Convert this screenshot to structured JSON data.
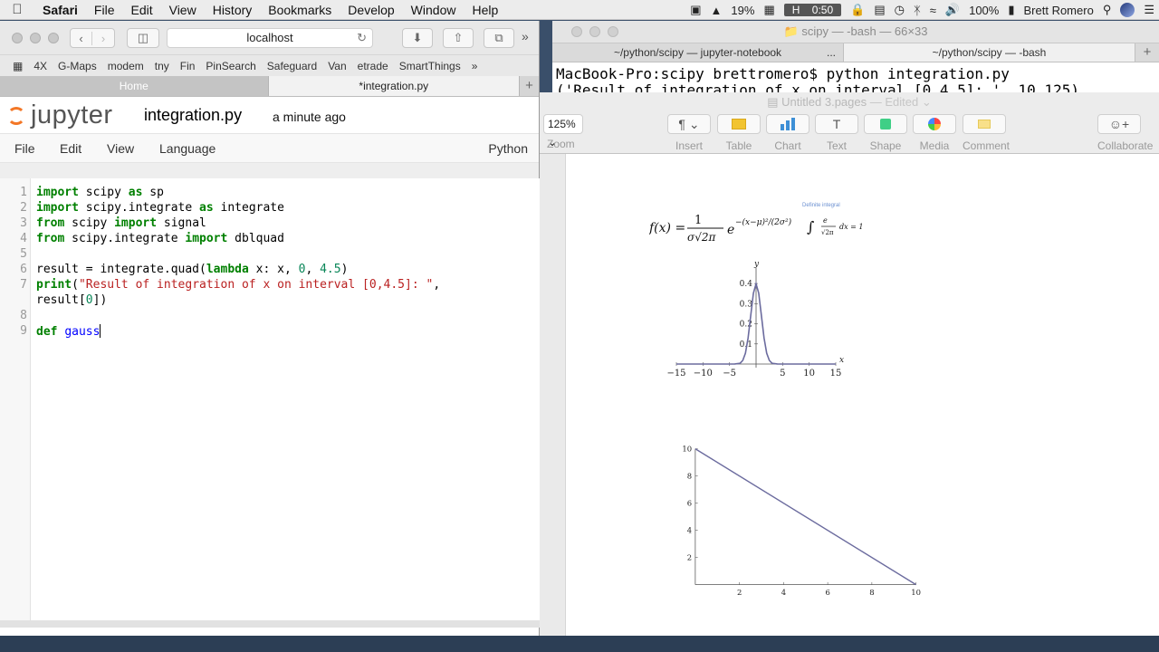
{
  "menubar": {
    "app": "Safari",
    "items": [
      "File",
      "Edit",
      "View",
      "History",
      "Bookmarks",
      "Develop",
      "Window",
      "Help"
    ],
    "battery_pct": "19%",
    "clock_label": "H",
    "time": "0:50",
    "volume_battery": "100%",
    "user": "Brett Romero"
  },
  "safari": {
    "address": "localhost",
    "bookmarks": [
      "4X",
      "G-Maps",
      "modem",
      "tny",
      "Fin",
      "PinSearch",
      "Safeguard",
      "Van",
      "etrade",
      "SmartThings"
    ],
    "tabs": [
      "Home",
      "*integration.py"
    ]
  },
  "jupyter": {
    "logo": "jupyter",
    "filename": "integration.py",
    "saved": "a minute ago",
    "menu": [
      "File",
      "Edit",
      "View",
      "Language"
    ],
    "kernel": "Python",
    "line_numbers": [
      "1",
      "2",
      "3",
      "4",
      "5",
      "6",
      "7",
      "8",
      "9"
    ]
  },
  "terminal": {
    "title": "scipy — -bash — 66×33",
    "tabs": [
      "~/python/scipy — jupyter-notebook",
      "~/python/scipy — -bash"
    ],
    "lines": [
      "MacBook-Pro:scipy brettromero$ python integration.py",
      "('Result of integration of x on interval [0,4.5]: ', 10.125)"
    ]
  },
  "pages": {
    "title": "Untitled 3.pages",
    "edited": "— Edited",
    "zoom": "125%",
    "zoom_label": "Zoom",
    "tools": [
      "Insert",
      "Table",
      "Chart",
      "Text",
      "Shape",
      "Media",
      "Comment",
      "Collaborate"
    ],
    "formula_caption": "Definite integral",
    "formula_rhs": "dx = 1"
  },
  "chart_data": [
    {
      "type": "line",
      "xlabel": "x",
      "ylabel": "y",
      "xlim": [
        -15,
        15
      ],
      "ylim": [
        0,
        0.45
      ],
      "x_ticks": [
        -15,
        -10,
        -5,
        5,
        10,
        15
      ],
      "y_ticks": [
        0.1,
        0.2,
        0.3,
        0.4
      ],
      "series": [
        {
          "x": [
            -15,
            -4,
            -3,
            -2.5,
            -2,
            -1.5,
            -1,
            -0.5,
            0,
            0.5,
            1,
            1.5,
            2,
            2.5,
            3,
            4,
            15
          ],
          "y": [
            0,
            0.0001,
            0.004,
            0.018,
            0.054,
            0.13,
            0.242,
            0.352,
            0.399,
            0.352,
            0.242,
            0.13,
            0.054,
            0.018,
            0.004,
            0.0001,
            0
          ]
        }
      ]
    },
    {
      "type": "line",
      "xlim": [
        0,
        10
      ],
      "ylim": [
        0,
        10
      ],
      "x_ticks": [
        2,
        4,
        6,
        8,
        10
      ],
      "y_ticks": [
        2,
        4,
        6,
        8,
        10
      ],
      "series": [
        {
          "x": [
            0,
            10
          ],
          "y": [
            10,
            0
          ]
        }
      ]
    }
  ]
}
